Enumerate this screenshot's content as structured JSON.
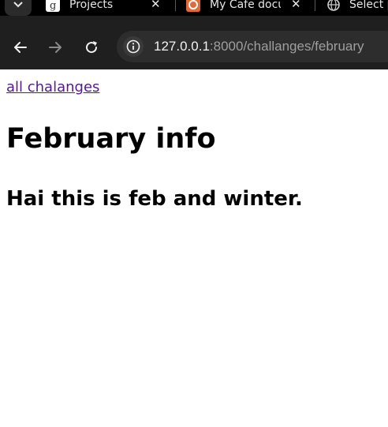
{
  "browser": {
    "tabs": [
      {
        "title": "Projects",
        "icon": "google-docs-icon"
      },
      {
        "title": "My Cafe docu",
        "icon": "cafe-app-icon"
      },
      {
        "title": "Select p",
        "icon": "globe-icon"
      }
    ],
    "close_glyph": "✕",
    "address": {
      "host": "127.0.0.1",
      "rest": ":8000/challanges/february"
    },
    "colors": {
      "chrome_bg": "#1f1f1f",
      "tabstrip_bg": "#000000",
      "omnibox_bg": "#2d2d2d"
    }
  },
  "page": {
    "back_link": "all chalanges",
    "heading": "February info",
    "subheading": "Hai this is feb and winter.",
    "link_color": "#551a8b"
  }
}
